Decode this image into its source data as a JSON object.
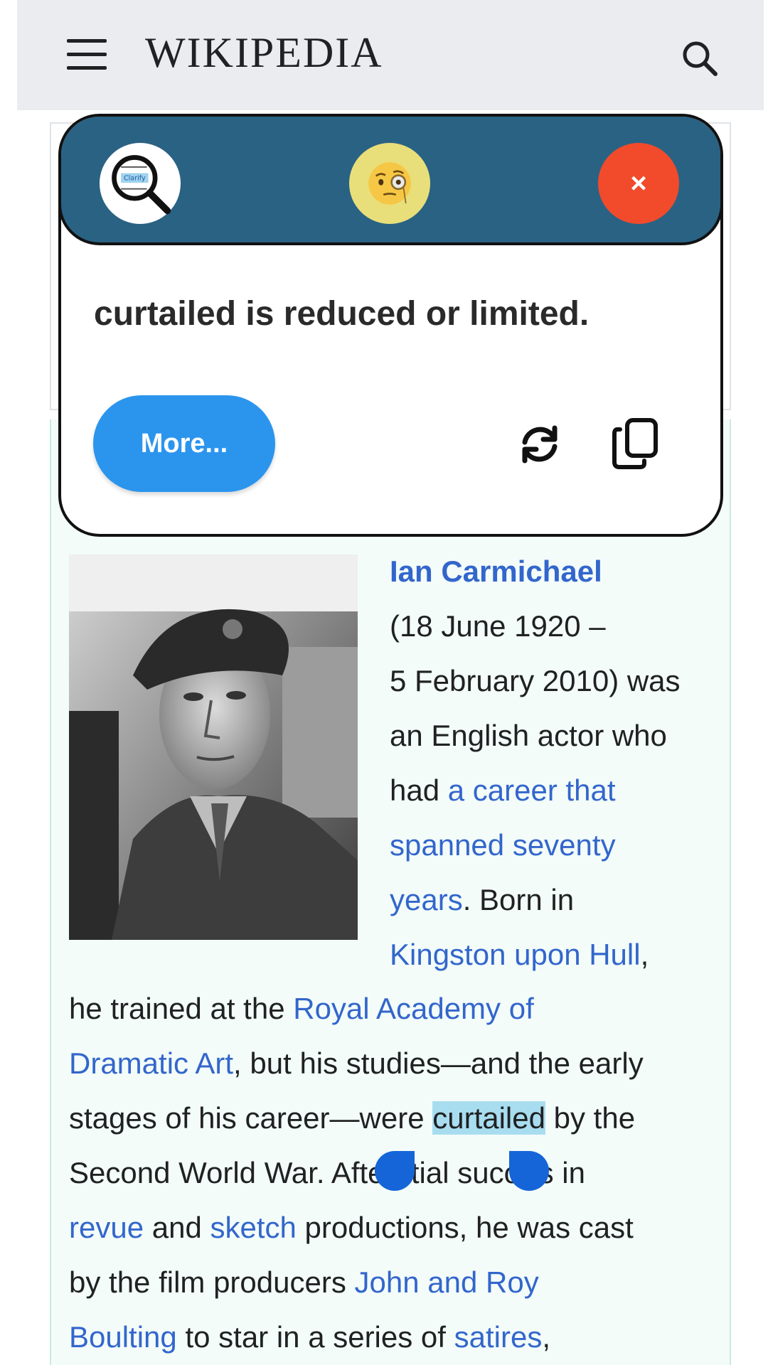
{
  "header": {
    "logo_text": "WIKIPEDIA",
    "menu_icon": "hamburger-menu-icon",
    "search_icon": "search-icon"
  },
  "popup": {
    "clarify_icon_label": "Clarify",
    "emoji_icon": "monocle-face-emoji",
    "close_label": "×",
    "definition": "curtailed is reduced or limited.",
    "more_label": "More...",
    "refresh_icon": "refresh-icon",
    "copy_icon": "copy-icon",
    "colors": {
      "bar": "#2a6284",
      "close": "#f14b2b",
      "more": "#2b95ee",
      "emoji_bg": "#e8df7a"
    }
  },
  "article": {
    "name": "Ian Carmichael",
    "side_lines": {
      "l2": "(18 June 1920 –",
      "l3": "5 February 2010) was",
      "l4": "an English actor who",
      "l5_pre": "had ",
      "l5_link": "a career that",
      "l6_link": "spanned seventy",
      "l7_link": "years",
      "l7_post": ". Born in",
      "l8_link": "Kingston upon Hull",
      "l8_post": ","
    },
    "body_lines": {
      "b1_pre": "he trained at the ",
      "b1_link": "Royal Academy of",
      "b2_link": "Dramatic Art",
      "b2_post": ", but his studies—and the early",
      "b3_pre": "stages of his career—were ",
      "b3_highlight": "curtailed",
      "b3_post": " by the",
      "b4_pre": "Second World War. Afte",
      "b4_mid": "itial succ",
      "b4_post": "s in",
      "b5_link1": "revue",
      "b5_mid": " and ",
      "b5_link2": "sketch",
      "b5_post": " productions, he was cast",
      "b6_pre": "by the film producers ",
      "b6_link": "John and Roy",
      "b7_link": "Boulting",
      "b7_mid": " to star in a series of ",
      "b7_link2": "satires",
      "b7_post": ","
    },
    "link_color": "#3366cc",
    "highlight_color": "#a8ddf0",
    "handle_color": "#1565d8"
  }
}
